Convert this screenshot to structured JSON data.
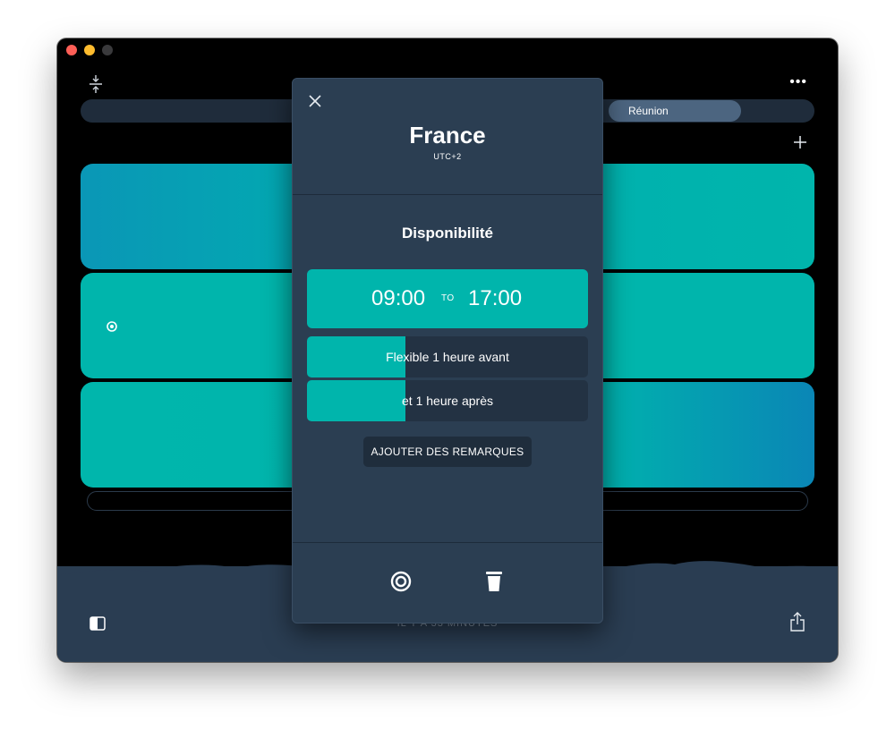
{
  "window": {
    "tab_active": "Réunion",
    "footer_text": "IL Y A 33 MINUTES"
  },
  "popover": {
    "country": "France",
    "utc": "UTC+2",
    "section_title": "Disponibilité",
    "time_from": "09:00",
    "time_separator": "TO",
    "time_until": "17:00",
    "flex_before_label": "Flexible 1 heure avant",
    "flex_before_level": 0.35,
    "flex_after_label": "et 1 heure après",
    "flex_after_level": 0.35,
    "notes_button": "AJOUTER DES REMARQUES"
  },
  "icons": {
    "close": "close-icon",
    "target": "target-icon",
    "trash": "trash-icon",
    "share": "share-icon",
    "sidebar": "sidebar-icon",
    "more": "more-icon",
    "plus": "plus-icon",
    "compress": "compress-icon"
  },
  "colors": {
    "accent": "#00b5ac",
    "panel": "#2b3e52",
    "tab_active": "#4c6580"
  }
}
